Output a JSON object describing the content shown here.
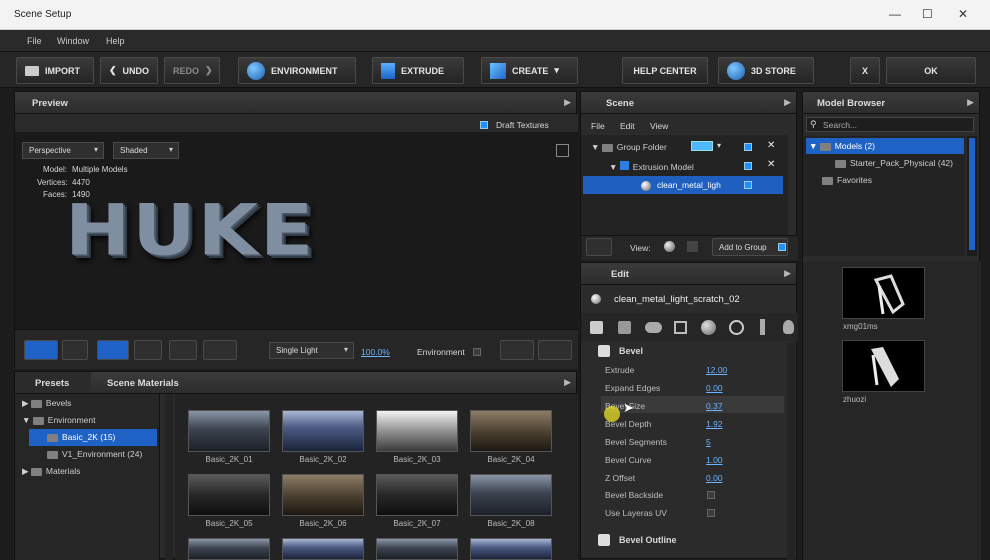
{
  "window": {
    "title": "Scene Setup",
    "controls": [
      "—",
      "☐",
      "✕"
    ]
  },
  "menu": [
    "File",
    "Window",
    "Help"
  ],
  "toolbar": {
    "import": "IMPORT",
    "undo": "UNDO",
    "redo": "REDO",
    "environment": "ENVIRONMENT",
    "extrude": "EXTRUDE",
    "create": "CREATE",
    "help": "HELP CENTER",
    "store": "3D STORE",
    "close": "X",
    "ok": "OK"
  },
  "preview": {
    "title": "Preview",
    "draft": "Draft Textures",
    "camera": "Perspective",
    "shading": "Shaded",
    "stats": [
      {
        "k": "Model:",
        "v": "Multiple Models"
      },
      {
        "k": "Vertices:",
        "v": "4470"
      },
      {
        "k": "Faces:",
        "v": "1490"
      }
    ],
    "text3d": "HUKE",
    "light": "Single Light",
    "zoom": "100.0%",
    "environment": "Environment"
  },
  "presets": {
    "tab1": "Presets",
    "tab2": "Scene Materials",
    "tree": [
      {
        "label": "Bevels",
        "level": 0
      },
      {
        "label": "Environment",
        "level": 0
      },
      {
        "label": "Basic_2K (15)",
        "level": 1,
        "selected": true
      },
      {
        "label": "V1_Environment (24)",
        "level": 1
      },
      {
        "label": "Materials",
        "level": 0
      }
    ],
    "thumbs": [
      "Basic_2K_01",
      "Basic_2K_02",
      "Basic_2K_03",
      "Basic_2K_04",
      "Basic_2K_05",
      "Basic_2K_06",
      "Basic_2K_07",
      "Basic_2K_08"
    ]
  },
  "scene": {
    "title": "Scene",
    "menu": [
      "File",
      "Edit",
      "View"
    ],
    "items": [
      {
        "label": "Group Folder"
      },
      {
        "label": "Extrusion Model"
      },
      {
        "label": "clean_metal_ligh"
      }
    ],
    "view": "View:",
    "add": "Add to Group"
  },
  "edit": {
    "title": "Edit",
    "material": "clean_metal_light_scratch_02",
    "section": "Bevel",
    "props": [
      {
        "label": "Extrude",
        "value": "12.00"
      },
      {
        "label": "Expand Edges",
        "value": "0.00"
      },
      {
        "label": "Bevel Size",
        "value": "0.37"
      },
      {
        "label": "Bevel Depth",
        "value": "1.92"
      },
      {
        "label": "Bevel Segments",
        "value": "5"
      },
      {
        "label": "Bevel Curve",
        "value": "1.00"
      },
      {
        "label": "Z Offset",
        "value": "0.00"
      }
    ],
    "checks": [
      "Bevel Backside",
      "Use Layeras UV"
    ],
    "section2": "Bevel Outline"
  },
  "browser": {
    "title": "Model Browser",
    "search": "Search...",
    "models": "Models (2)",
    "starter": "Starter_Pack_Physical (42)",
    "favorites": "Favorites",
    "thumbs": [
      "xmg01ms",
      "zhuozi"
    ]
  }
}
